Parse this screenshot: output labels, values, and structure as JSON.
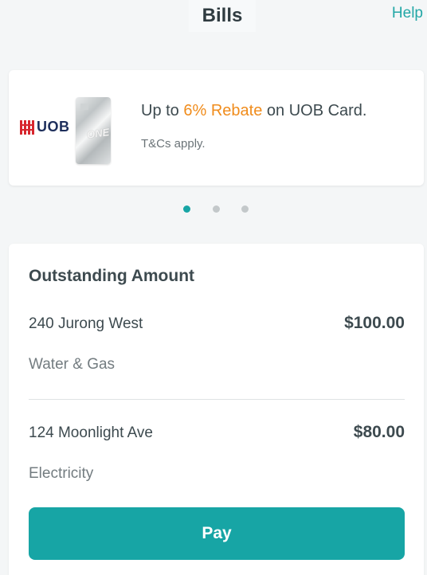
{
  "header": {
    "title": "Bills",
    "help_label": "Help"
  },
  "promo": {
    "brand_logo_text": "UOB",
    "headline_prefix": "Up to ",
    "headline_accent": "6% Rebate",
    "headline_suffix": " on UOB Card.",
    "subtext": "T&Cs apply.",
    "accent_color": "#f08c1c",
    "brand_color": "#d7262e"
  },
  "carousel": {
    "total_pages": 3,
    "active_page": 1,
    "active_color": "#17a5a5",
    "inactive_color": "#c3c8ca"
  },
  "outstanding": {
    "title": "Outstanding Amount",
    "bills": [
      {
        "address": "240 Jurong West",
        "amount": "$100.00",
        "type": "Water & Gas"
      },
      {
        "address": "124 Moonlight Ave",
        "amount": "$80.00",
        "type": "Electricity"
      }
    ],
    "pay_label": "Pay",
    "pay_color": "#17a5a5"
  }
}
